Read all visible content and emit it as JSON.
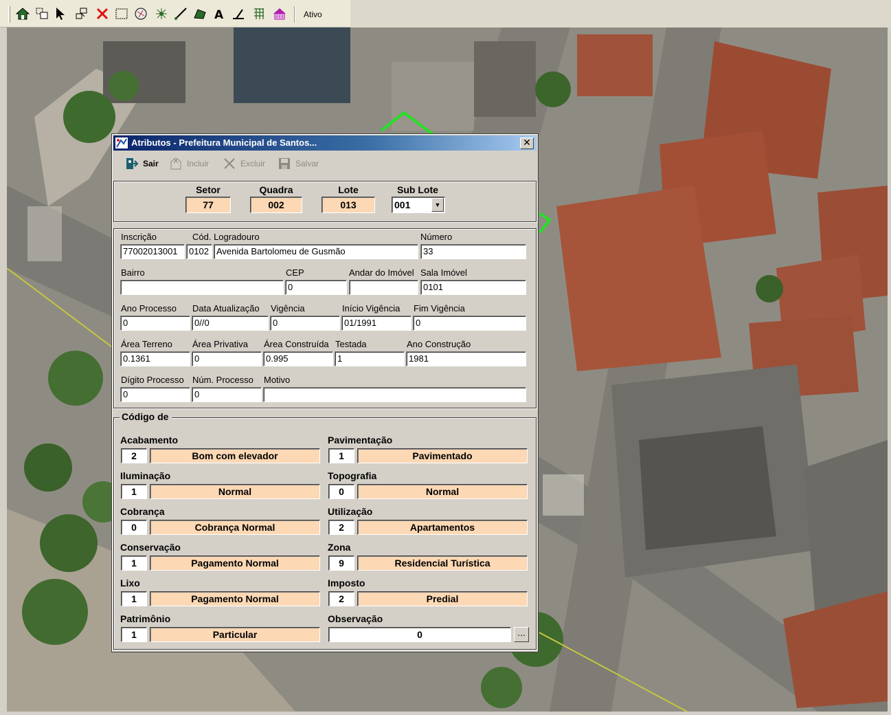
{
  "toolbar": {
    "icons": [
      "home-icon",
      "layers-icon",
      "select-arrow-icon",
      "select-area-icon",
      "delete-icon",
      "rectangle-select-icon",
      "map-info-icon",
      "point-tool-icon",
      "line-tool-icon",
      "polygon-tool-icon",
      "text-tool-icon",
      "measure-icon",
      "grid-icon",
      "building-icon"
    ],
    "status": "Ativo"
  },
  "dialog": {
    "title": "Atributos - Prefeitura Municipal de Santos...",
    "close": "✕",
    "buttons": {
      "sair": "Sair",
      "incluir": "Incluir",
      "excluir": "Excluir",
      "salvar": "Salvar"
    },
    "id": {
      "setor_label": "Setor",
      "setor": "77",
      "quadra_label": "Quadra",
      "quadra": "002",
      "lote_label": "Lote",
      "lote": "013",
      "sublote_label": "Sub Lote",
      "sublote": "001"
    },
    "fields": {
      "inscricao_label": "Inscrição",
      "inscricao": "77002013001",
      "cod_logradouro_label": "Cód. Logradouro",
      "cod_logradouro": "0102",
      "logradouro": "Avenida Bartolomeu de Gusmão",
      "numero_label": "Número",
      "numero": "33",
      "bairro_label": "Bairro",
      "bairro": "",
      "cep_label": "CEP",
      "cep": "0",
      "andar_label": "Andar do Imóvel",
      "andar": "",
      "sala_label": "Sala Imóvel",
      "sala": "0101",
      "ano_processo_label": "Ano Processo",
      "ano_processo": "0",
      "data_atualizacao_label": "Data Atualização",
      "data_atualizacao": "0//0",
      "vigencia_label": "Vigência",
      "vigencia": "0",
      "inicio_vigencia_label": "Início Vigência",
      "inicio_vigencia": "01/1991",
      "fim_vigencia_label": "Fim Vigência",
      "fim_vigencia": "0",
      "area_terreno_label": "Área Terreno",
      "area_terreno": "0.1361",
      "area_privativa_label": "Área Privativa",
      "area_privativa": "0",
      "area_construida_label": "Área Construída",
      "area_construida": "0.995",
      "testada_label": "Testada",
      "testada": "1",
      "ano_construcao_label": "Ano Construção",
      "ano_construcao": "1981",
      "digito_processo_label": "Dígito Processo",
      "digito_processo": "0",
      "num_processo_label": "Núm. Processo",
      "num_processo": "0",
      "motivo_label": "Motivo",
      "motivo": ""
    },
    "codigos": {
      "legend": "Código de",
      "acabamento": {
        "label": "Acabamento",
        "code": "2",
        "desc": "Bom com elevador"
      },
      "pavimentacao": {
        "label": "Pavimentação",
        "code": "1",
        "desc": "Pavimentado"
      },
      "iluminacao": {
        "label": "Iluminação",
        "code": "1",
        "desc": "Normal"
      },
      "topografia": {
        "label": "Topografia",
        "code": "0",
        "desc": "Normal"
      },
      "cobranca": {
        "label": "Cobrança",
        "code": "0",
        "desc": "Cobrança Normal"
      },
      "utilizacao": {
        "label": "Utilização",
        "code": "2",
        "desc": "Apartamentos"
      },
      "conservacao": {
        "label": "Conservação",
        "code": "1",
        "desc": "Pagamento Normal"
      },
      "zona": {
        "label": "Zona",
        "code": "9",
        "desc": "Residencial Turística"
      },
      "lixo": {
        "label": "Lixo",
        "code": "1",
        "desc": "Pagamento Normal"
      },
      "imposto": {
        "label": "Imposto",
        "code": "2",
        "desc": "Predial"
      },
      "patrimonio": {
        "label": "Patrimônio",
        "code": "1",
        "desc": "Particular"
      },
      "observacao": {
        "label": "Observação",
        "value": "0",
        "button": "..."
      }
    }
  }
}
